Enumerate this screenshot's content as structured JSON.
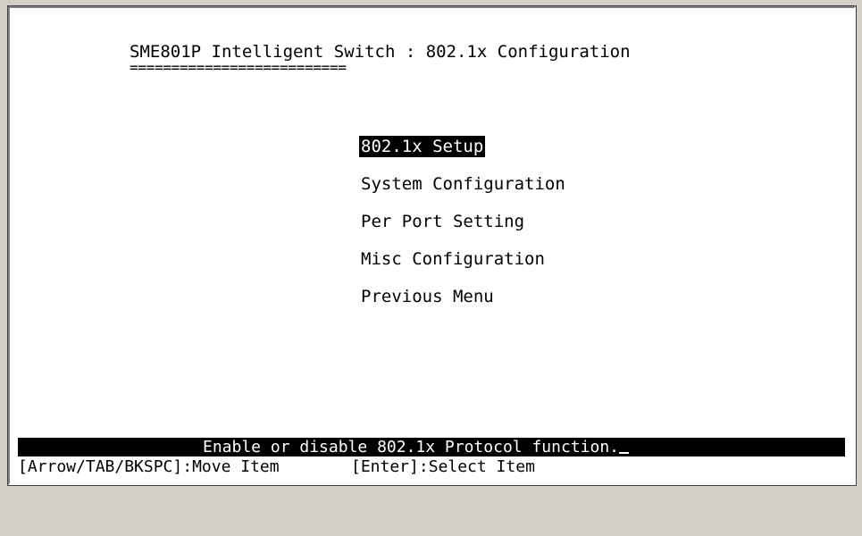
{
  "header": {
    "title": "SME801P Intelligent Switch : 802.1x Configuration",
    "underline": "=========================="
  },
  "menu": {
    "items": [
      {
        "label": "802.1x Setup",
        "selected": true
      },
      {
        "label": "System Configuration",
        "selected": false
      },
      {
        "label": "Per Port Setting",
        "selected": false
      },
      {
        "label": "Misc Configuration",
        "selected": false
      },
      {
        "label": "Previous Menu",
        "selected": false
      }
    ]
  },
  "status": {
    "message": "Enable or disable 802.1x Protocol function."
  },
  "help": {
    "navigation": "[Arrow/TAB/BKSPC]:Move Item",
    "select": "[Enter]:Select Item"
  },
  "colors": {
    "background": "#ffffff",
    "text": "#000000",
    "highlight_bg": "#000000",
    "highlight_fg": "#ffffff",
    "window_chrome": "#d4d0c8"
  }
}
